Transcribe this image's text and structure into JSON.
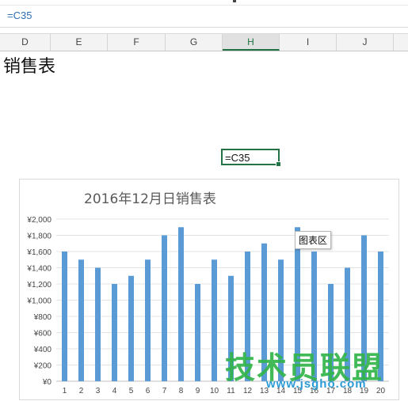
{
  "formula_bar": {
    "content": "=C35"
  },
  "column_headers": [
    "D",
    "E",
    "F",
    "G",
    "H",
    "I",
    "J"
  ],
  "active_column": "H",
  "sheet": {
    "title": "销售表",
    "selected_cell_value": "=C35"
  },
  "chart": {
    "tooltip": "图表区"
  },
  "watermark": {
    "cn": "技术员联盟",
    "en": "www.jsgho.com"
  },
  "chart_data": {
    "type": "bar",
    "title": "2016年12月日销售表",
    "categories": [
      "1",
      "2",
      "3",
      "4",
      "5",
      "6",
      "7",
      "8",
      "9",
      "10",
      "11",
      "12",
      "13",
      "14",
      "15",
      "16",
      "17",
      "18",
      "19",
      "20"
    ],
    "values": [
      1600,
      1500,
      1400,
      1200,
      1300,
      1500,
      1800,
      1900,
      1200,
      1500,
      1300,
      1600,
      1700,
      1500,
      1900,
      1600,
      1200,
      1400,
      1800,
      1600
    ],
    "ylim": [
      0,
      2000
    ],
    "yticks": [
      "¥0",
      "¥200",
      "¥400",
      "¥600",
      "¥800",
      "¥1,000",
      "¥1,200",
      "¥1,400",
      "¥1,600",
      "¥1,800",
      "¥2,000"
    ],
    "xlabel": "",
    "ylabel": "",
    "grid": true,
    "bar_color": "#5b9bd5"
  }
}
